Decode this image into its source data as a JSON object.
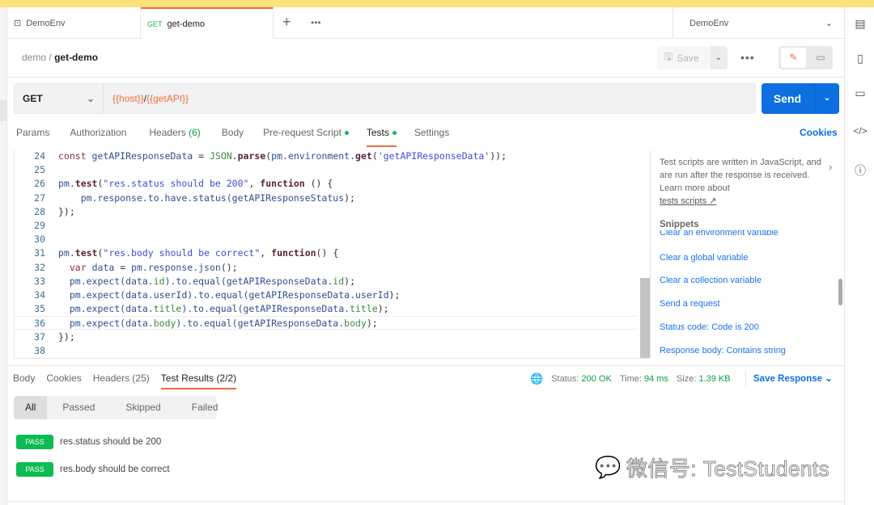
{
  "tabs": [
    {
      "label": "DemoEnv",
      "icon": "environment-icon"
    },
    {
      "method": "GET",
      "label": "get-demo"
    }
  ],
  "env_select": "DemoEnv",
  "breadcrumb": {
    "parent": "demo",
    "sep": "/",
    "current": "get-demo"
  },
  "toolbar": {
    "save": "Save",
    "more": "•••"
  },
  "request": {
    "method": "GET",
    "url_host": "{{host}}",
    "url_sep": "/",
    "url_path": "{{getAPI}}",
    "send": "Send"
  },
  "req_tabs": [
    {
      "label": "Params"
    },
    {
      "label": "Authorization"
    },
    {
      "label": "Headers",
      "count": "(6)"
    },
    {
      "label": "Body"
    },
    {
      "label": "Pre-request Script",
      "dot": true
    },
    {
      "label": "Tests",
      "dot": true,
      "active": true
    },
    {
      "label": "Settings"
    }
  ],
  "cookies": "Cookies",
  "code": [
    {
      "n": "24",
      "t": [
        [
          "kw",
          "const "
        ],
        [
          "id",
          "getAPIResponseData "
        ],
        [
          "p",
          "= "
        ],
        [
          "prop",
          "JSON"
        ],
        [
          "p",
          "."
        ],
        [
          "fnb",
          "parse"
        ],
        [
          "p",
          "("
        ],
        [
          "id",
          "pm.environment."
        ],
        [
          "fnb",
          "get"
        ],
        [
          "p",
          "("
        ],
        [
          "str",
          "'getAPIResponseData'"
        ],
        [
          "p",
          "));"
        ]
      ]
    },
    {
      "n": "25",
      "t": []
    },
    {
      "n": "26",
      "t": [
        [
          "id",
          "pm."
        ],
        [
          "fnb",
          "test"
        ],
        [
          "p",
          "("
        ],
        [
          "str",
          "\"res.status should be 200\""
        ],
        [
          "p",
          ", "
        ],
        [
          "fnb",
          "function"
        ],
        [
          "p",
          " () {"
        ]
      ]
    },
    {
      "n": "27",
      "t": [
        [
          "p",
          "    "
        ],
        [
          "id",
          "pm.response.to.have.status("
        ],
        [
          "id",
          "getAPIResponseStatus"
        ],
        [
          "p",
          ");"
        ]
      ]
    },
    {
      "n": "28",
      "t": [
        [
          "p",
          "});"
        ]
      ]
    },
    {
      "n": "29",
      "t": []
    },
    {
      "n": "30",
      "t": []
    },
    {
      "n": "31",
      "t": [
        [
          "id",
          "pm."
        ],
        [
          "fnb",
          "test"
        ],
        [
          "p",
          "("
        ],
        [
          "str",
          "\"res.body should be correct\""
        ],
        [
          "p",
          ", "
        ],
        [
          "fnb",
          "function"
        ],
        [
          "p",
          "() {"
        ]
      ]
    },
    {
      "n": "32",
      "t": [
        [
          "p",
          "  "
        ],
        [
          "kw",
          "var "
        ],
        [
          "id",
          "data "
        ],
        [
          "p",
          "= "
        ],
        [
          "id",
          "pm.response.json"
        ],
        [
          "p",
          "();"
        ]
      ]
    },
    {
      "n": "33",
      "t": [
        [
          "p",
          "  "
        ],
        [
          "id",
          "pm.expect(data."
        ],
        [
          "prop",
          "id"
        ],
        [
          "id",
          ").to.equal(getAPIResponseData."
        ],
        [
          "prop",
          "id"
        ],
        [
          "p",
          ");"
        ]
      ]
    },
    {
      "n": "34",
      "t": [
        [
          "p",
          "  "
        ],
        [
          "id",
          "pm.expect(data.userId).to.equal(getAPIResponseData.userId"
        ],
        [
          "p",
          ");"
        ]
      ]
    },
    {
      "n": "35",
      "t": [
        [
          "p",
          "  "
        ],
        [
          "id",
          "pm.expect(data."
        ],
        [
          "prop",
          "title"
        ],
        [
          "id",
          ").to.equal(getAPIResponseData."
        ],
        [
          "prop",
          "title"
        ],
        [
          "p",
          ");"
        ]
      ]
    },
    {
      "n": "36",
      "t": [
        [
          "p",
          "  "
        ],
        [
          "id",
          "pm.expect(data."
        ],
        [
          "prop",
          "body"
        ],
        [
          "id",
          ").to.equal(getAPIResponseData."
        ],
        [
          "prop",
          "body"
        ],
        [
          "p",
          ");"
        ]
      ]
    },
    {
      "n": "37",
      "t": [
        [
          "p",
          "});"
        ]
      ]
    },
    {
      "n": "38",
      "t": []
    }
  ],
  "side": {
    "text": "Test scripts are written in JavaScript, and are run after the response is received. Learn more about",
    "link": "tests scripts ↗",
    "snippets_title": "Snippets",
    "snippets": [
      "Clear an environment variable",
      "Clear a global variable",
      "Clear a collection variable",
      "Send a request",
      "Status code: Code is 200",
      "Response body: Contains string"
    ]
  },
  "response": {
    "tabs": [
      {
        "label": "Body"
      },
      {
        "label": "Cookies"
      },
      {
        "label": "Headers (25)"
      },
      {
        "label": "Test Results (2/2)",
        "active": true
      }
    ],
    "status_label": "Status:",
    "status": "200 OK",
    "time_label": "Time:",
    "time": "94 ms",
    "size_label": "Size:",
    "size": "1.39 KB",
    "save": "Save Response",
    "filters": [
      "All",
      "Passed",
      "Skipped",
      "Failed"
    ],
    "results": [
      {
        "badge": "PASS",
        "name": "res.status should be 200"
      },
      {
        "badge": "PASS",
        "name": "res.body should be correct"
      }
    ]
  },
  "watermark": "微信号: TestStudents",
  "colors": {
    "accent": "#f26b3a",
    "primary": "#0d6fe0",
    "pass": "#0cbb52",
    "banner": "#fbe27a"
  }
}
